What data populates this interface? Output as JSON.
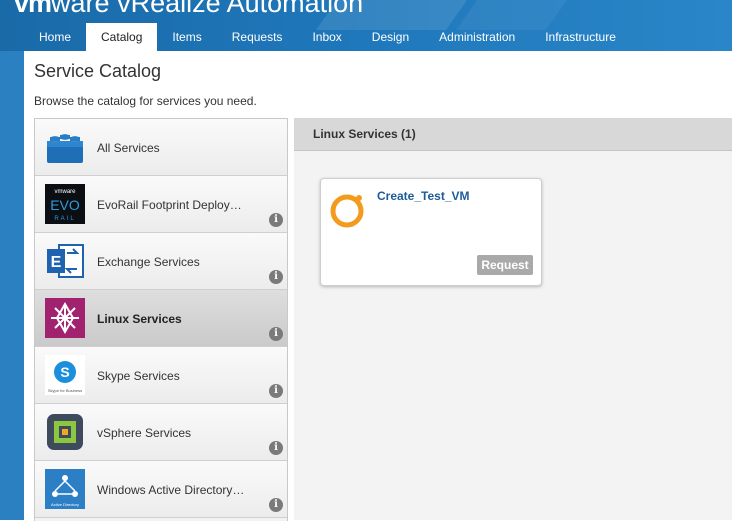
{
  "header": {
    "brand_bold": "vm",
    "brand_rest": "ware",
    "product": " vRealize Automation"
  },
  "nav": {
    "tabs": [
      "Home",
      "Catalog",
      "Items",
      "Requests",
      "Inbox",
      "Design",
      "Administration",
      "Infrastructure"
    ],
    "active": "Catalog"
  },
  "page": {
    "title": "Service Catalog",
    "subtitle": "Browse the catalog for services you need."
  },
  "services": [
    {
      "label": "All Services",
      "icon": "lego-brick-icon",
      "info": false,
      "selected": false
    },
    {
      "label": "EvoRail Footprint Deploy…",
      "icon": "vmware-evo-rail-icon",
      "info": true,
      "selected": false
    },
    {
      "label": "Exchange Services",
      "icon": "exchange-icon",
      "info": true,
      "selected": false
    },
    {
      "label": "Linux Services",
      "icon": "linux-services-icon",
      "info": true,
      "selected": true
    },
    {
      "label": "Skype Services",
      "icon": "skype-icon",
      "info": true,
      "selected": false
    },
    {
      "label": "vSphere Services",
      "icon": "vsphere-icon",
      "info": true,
      "selected": false
    },
    {
      "label": "Windows Active Directory…",
      "icon": "active-directory-icon",
      "info": true,
      "selected": false
    }
  ],
  "icon_text": {
    "evo_vm": "vmware",
    "evo": "EVO",
    "rail": "RAIL",
    "exchange": "E",
    "skype": "S",
    "skype_caption": "Skype for Business",
    "ad_caption": "Active Directory"
  },
  "info_glyph": "i",
  "panel": {
    "title": "Linux Services (1)"
  },
  "catalog_items": [
    {
      "name": "Create_Test_VM",
      "icon": "orange-ring-icon",
      "button": "Request"
    }
  ],
  "colors": {
    "header_blue": "#1f78bb",
    "link_blue": "#1d5c98",
    "request_gray": "#a9a9a9",
    "ring_orange": "#f29b1d"
  }
}
